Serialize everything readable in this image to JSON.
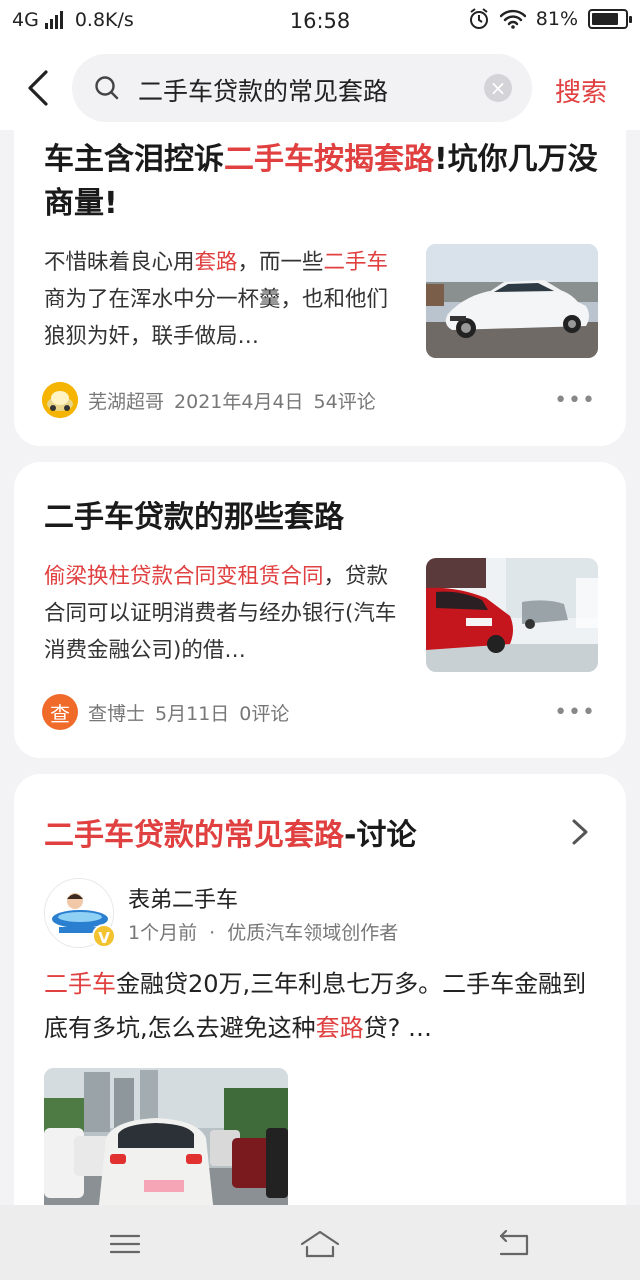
{
  "status_bar": {
    "network": "4G",
    "speed": "0.8K/s",
    "time": "16:58",
    "battery": "81%",
    "battery_level": 0.81
  },
  "search": {
    "query": "二手车贷款的常见套路",
    "submit_label": "搜索",
    "clear_label": "×"
  },
  "results": [
    {
      "title": [
        "车主含泪控诉",
        "二手车按揭套路",
        "!坑你几万没商量!"
      ],
      "excerpt": [
        "不惜昧着良心用",
        "套路",
        "，而一些",
        "二手车",
        "商为了在浑水中分一杯羹，也和他们狼狈为奸，联手做局…"
      ],
      "source": "芜湖超哥",
      "date": "2021年4月4日",
      "comments": "54评论",
      "more": "•••"
    },
    {
      "title": "二手车贷款的那些套路",
      "excerpt": [
        "偷梁换柱贷款合同变租赁合同",
        "，贷款合同可以证明消费者与经办银行(汽车消费金融公司)的借…"
      ],
      "source": "查博士",
      "source_avatar_char": "查",
      "date": "5月11日",
      "comments": "0评论",
      "more": "•••"
    }
  ],
  "discussion": {
    "title_highlight": "二手车贷款的常见套路",
    "title_suffix": "-讨论",
    "author": "表弟二手车",
    "time": "1个月前",
    "separator": "·",
    "author_tag": "优质汽车领域创作者",
    "badge": "V",
    "post": [
      "二手车",
      "金融贷20万,三年利息七万多。二手车金融到底有多坑,怎么去避免这种",
      "套路",
      "贷? …"
    ]
  },
  "colors": {
    "accent": "#e04040",
    "background": "#f3f3f6"
  },
  "nav": {
    "icons": [
      "menu-icon",
      "home-icon",
      "back-icon"
    ]
  }
}
